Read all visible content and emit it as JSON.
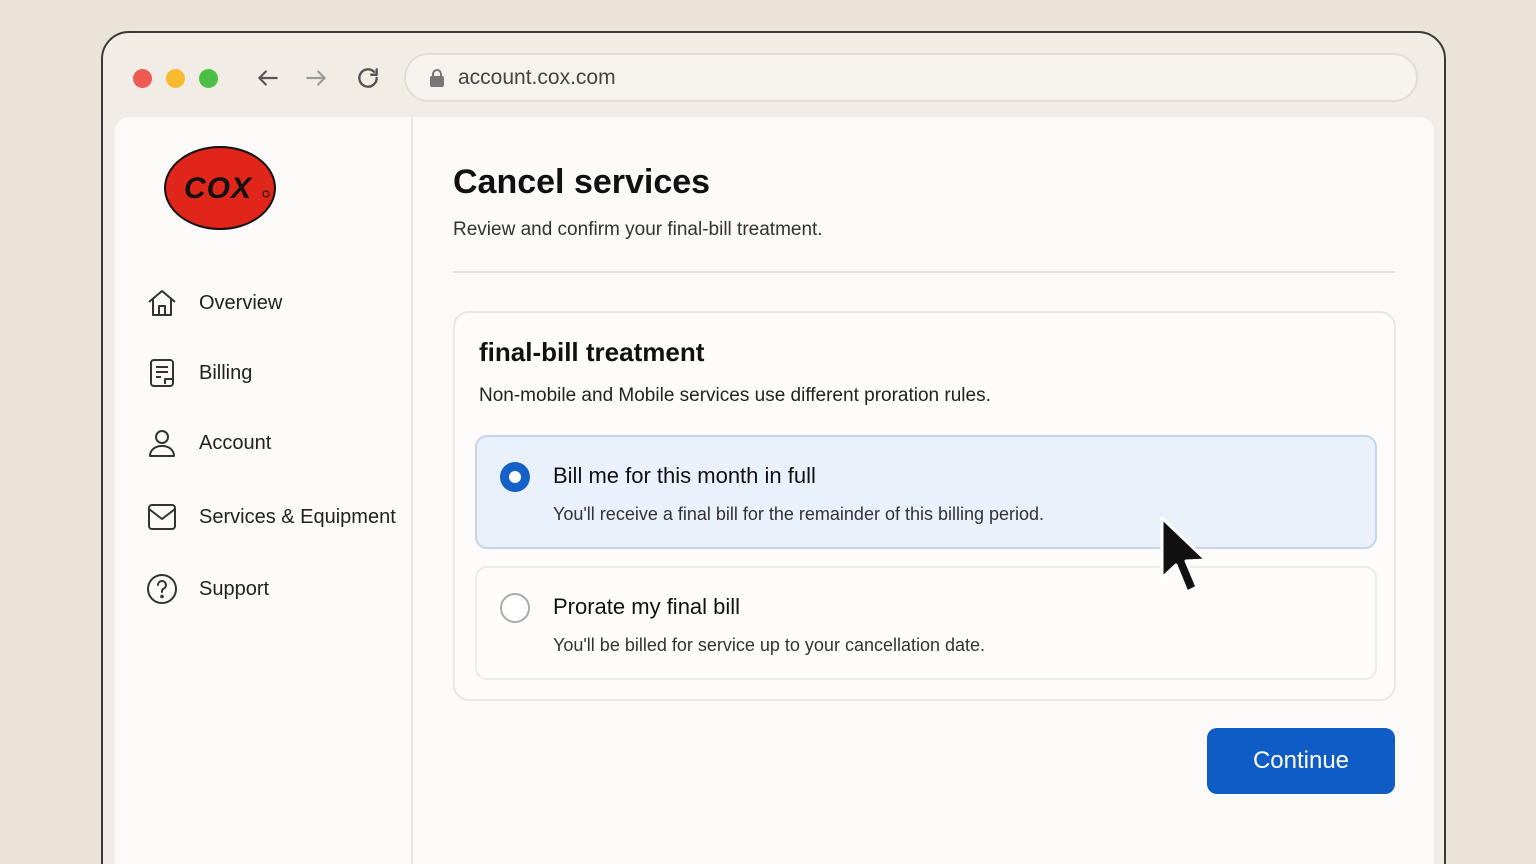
{
  "browser": {
    "url": "account.cox.com"
  },
  "brand": {
    "logo_text": "COX",
    "logo_color": "#e0251b"
  },
  "sidebar": {
    "items": [
      {
        "label": "Overview",
        "icon": "home-icon"
      },
      {
        "label": "Billing",
        "icon": "bill-icon"
      },
      {
        "label": "Account",
        "icon": "user-icon"
      },
      {
        "label": "Services & Equipment",
        "icon": "mail-icon"
      },
      {
        "label": "Support",
        "icon": "question-icon"
      }
    ]
  },
  "main": {
    "title": "Cancel services",
    "subtitle": "Review and confirm your final-bill treatment."
  },
  "card": {
    "title": "final-bill treatment",
    "description": "Non-mobile and Mobile services use different proration rules.",
    "options": [
      {
        "title": "Bill me for this month in full",
        "description": "You'll receive a final bill for the remainder of this billing period.",
        "selected": true
      },
      {
        "title": "Prorate my final bill",
        "description": "You'll be billed for service up to your cancellation date.",
        "selected": false
      }
    ]
  },
  "actions": {
    "continue_label": "Continue"
  },
  "colors": {
    "accent": "#0f5cc7",
    "selected_bg": "#eaf1fb"
  }
}
